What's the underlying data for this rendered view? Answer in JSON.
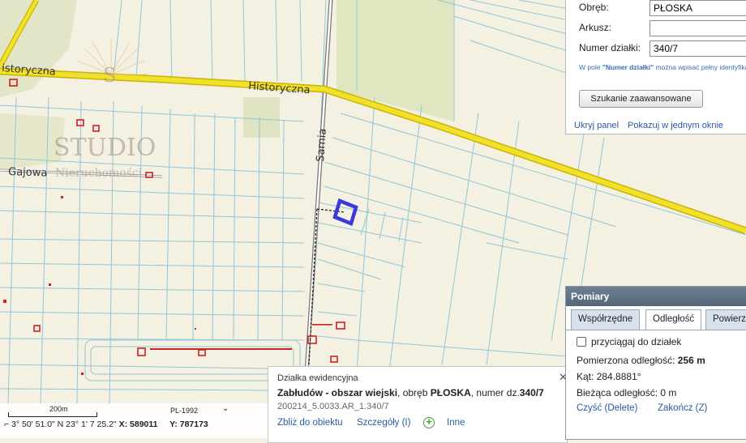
{
  "map": {
    "roads": [
      {
        "name": "Historyczna",
        "label": "Historyczna"
      },
      {
        "name": "Historyczna-west",
        "label": "istoryczna"
      },
      {
        "name": "Sarnia",
        "label": "Sarnia"
      },
      {
        "name": "Gajowa",
        "label": "Gajowa"
      }
    ],
    "watermark": {
      "letter": "S",
      "word": "STUDIO",
      "sub": "Nieruchomości"
    },
    "colors": {
      "background": "#f4f0e2",
      "parcel_line": "#8fc7d8",
      "road": "#f2e12a",
      "road_edge": "#c9b400",
      "selected_parcel": "#3a3adc",
      "building": "#cc2222",
      "meadow": "#dfe6c4"
    }
  },
  "search": {
    "obreb_label": "Obręb:",
    "obreb_value": "PŁOSKA",
    "arkusz_label": "Arkusz:",
    "arkusz_value": "",
    "numer_label": "Numer działki:",
    "numer_value": "340/7",
    "hint_pre": "W pole ",
    "hint_bold": "\"Numer działki\"",
    "hint_post": " można wpisać pełny identyfikator",
    "advanced_button": "Szukanie zaawansowane",
    "hide_link": "Ukryj panel",
    "show_link": "Pokazuj w jednym oknie"
  },
  "info": {
    "title": "Działka ewidencyjna",
    "location_bold": "Zabłudów - obszar wiejski",
    "location_mid": ", obręb ",
    "obreb_bold": "PŁOSKA",
    "number_pre": ", numer dz.",
    "number_bold": "340/7",
    "code": "200214_5.0033.AR_1.340/7",
    "zoom_link": "Zbliż do obiektu",
    "details_link": "Szczegóły (I)",
    "other_link": "Inne",
    "close": "✕"
  },
  "measure": {
    "title": "Pomiary",
    "tabs": [
      "Współrzędne",
      "Odległość",
      "Powierzchnia"
    ],
    "active_tab": "Odległość",
    "snap_label": "przyciągaj do działek",
    "snap_checked": false,
    "measured_label": "Pomierzona odległość:",
    "measured_value": "256 m",
    "angle_label": "Kąt:",
    "angle_value": "284.8881°",
    "current_label": "Bieżąca odległość:",
    "current_value": "0 m",
    "clear_button": "Czyść (Delete)",
    "finish_button": "Zakończ (Z)"
  },
  "coords": {
    "scale_label": "200m",
    "projection": "PL-1992",
    "prefix": "⌐ 3° 50' 51.0\" N 23° 1' 7 25.2\"",
    "x_label": "X:",
    "x_value": "589011",
    "y_label": "Y:",
    "y_value": "787173"
  }
}
